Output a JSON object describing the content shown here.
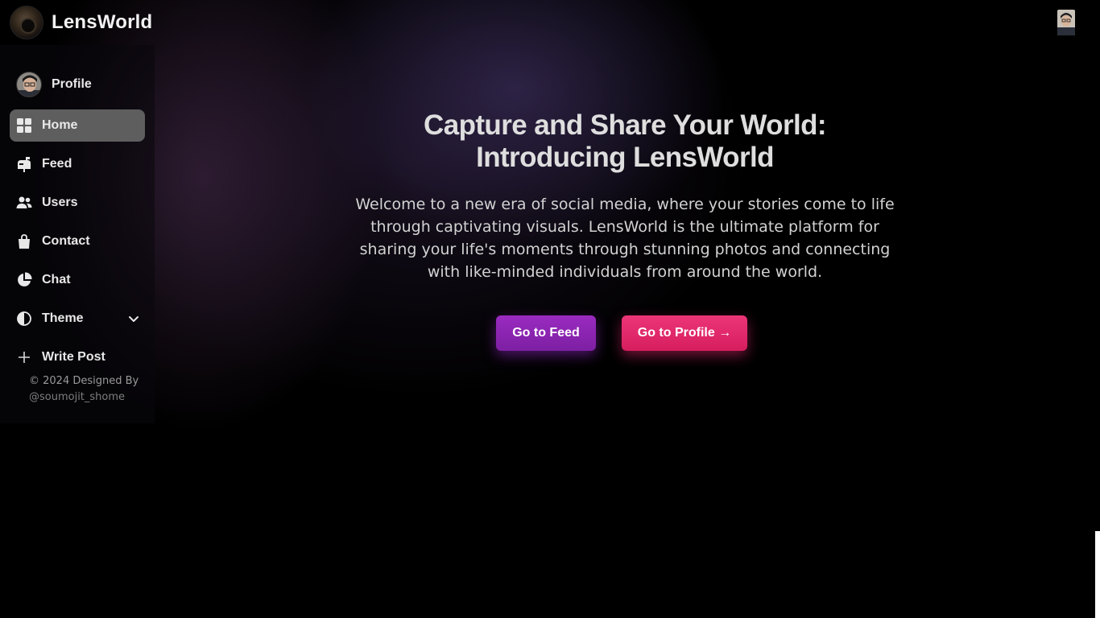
{
  "app": {
    "brand_name": "LensWorld"
  },
  "sidebar": {
    "profile_label": "Profile",
    "items": [
      {
        "label": "Home",
        "icon": "grid-icon",
        "active": true
      },
      {
        "label": "Feed",
        "icon": "mailbox-icon",
        "active": false
      },
      {
        "label": "Users",
        "icon": "users-icon",
        "active": false
      },
      {
        "label": "Contact",
        "icon": "bag-icon",
        "active": false
      },
      {
        "label": "Chat",
        "icon": "pie-chart-icon",
        "active": false
      },
      {
        "label": "Theme",
        "icon": "contrast-icon",
        "active": false
      },
      {
        "label": "Write Post",
        "icon": "plus-icon",
        "active": false
      }
    ],
    "footer_prefix": "© 2024 Designed By ",
    "footer_handle": "@soumojit_shome"
  },
  "hero": {
    "title_line1": "Capture and Share Your World:",
    "title_line2": "Introducing LensWorld",
    "description": "Welcome to a new era of social media, where your stories come to life through captivating visuals. LensWorld is the ultimate platform for sharing your life's moments through stunning photos and connecting with like-minded individuals from around the world.",
    "feed_button": "Go to Feed",
    "profile_button": "Go to Profile →"
  },
  "colors": {
    "feed_button": "#8e24aa",
    "profile_button": "#e62b6b",
    "active_nav": "#5e5e5e",
    "background": "#000000"
  }
}
